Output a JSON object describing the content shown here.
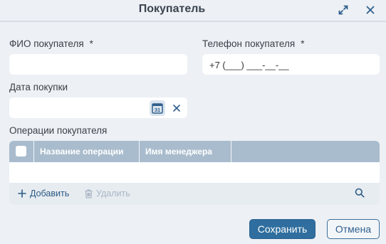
{
  "dialog": {
    "title": "Покупатель",
    "expand_icon": "expand-icon",
    "close_icon": "close-icon"
  },
  "form": {
    "fio": {
      "label": "ФИО покупателя",
      "required_mark": "*",
      "value": ""
    },
    "phone": {
      "label": "Телефон покупателя",
      "required_mark": "*",
      "value": "+7 (___) ___-__-__"
    },
    "date": {
      "label": "Дата покупки",
      "value": "",
      "calendar_icon": "calendar-icon",
      "calendar_glyph": "31",
      "clear_icon": "clear-icon"
    }
  },
  "operations": {
    "label": "Операции покупателя",
    "columns": [
      "Название операции",
      "Имя менеджера"
    ],
    "rows": [],
    "add_label": "Добавить",
    "delete_label": "Удалить",
    "search_icon": "search-icon"
  },
  "buttons": {
    "save_label": "Сохранить",
    "cancel_label": "Отмена"
  },
  "colors": {
    "primary": "#2f6e9e",
    "grid_header": "#a9bccd",
    "background": "#edf0f4"
  }
}
